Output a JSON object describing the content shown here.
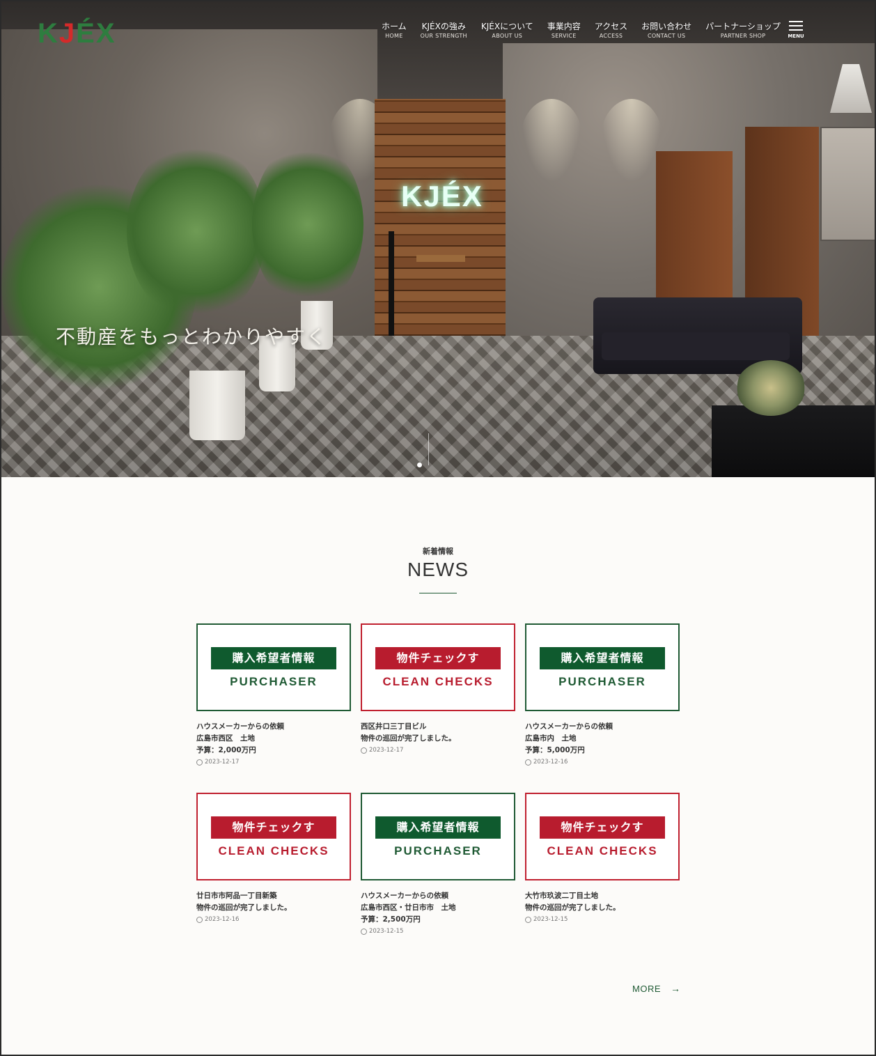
{
  "header": {
    "logo": {
      "k": "K",
      "j": "J",
      "ex": "ÉX"
    },
    "nav": [
      {
        "jp": "ホーム",
        "en": "HOME"
      },
      {
        "jp": "KJÉXの強み",
        "en": "OUR STRENGTH"
      },
      {
        "jp": "KJÉXについて",
        "en": "ABOUT US"
      },
      {
        "jp": "事業内容",
        "en": "SERVICE"
      },
      {
        "jp": "アクセス",
        "en": "ACCESS"
      },
      {
        "jp": "お問い合わせ",
        "en": "CONTACT US"
      },
      {
        "jp": "パートナーショップ",
        "en": "PARTNER SHOP"
      }
    ],
    "menu_label": "MENU"
  },
  "hero": {
    "tagline": "不動産をもっとわかりやすく",
    "sign_text": "KJÉX"
  },
  "news": {
    "subtitle": "新着情報",
    "title": "NEWS",
    "items": [
      {
        "type": "green",
        "band": "購入希望者情報",
        "en": "PURCHASER",
        "lines": [
          "ハウスメーカーからの依頼",
          "広島市西区　土地",
          "予算：2,000万円"
        ],
        "date": "2023-12-17"
      },
      {
        "type": "red",
        "band": "物件チェックす",
        "en": "CLEAN CHECKS",
        "lines": [
          "西区井口三丁目ビル",
          "物件の巡回が完了しました。"
        ],
        "date": "2023-12-17"
      },
      {
        "type": "green",
        "band": "購入希望者情報",
        "en": "PURCHASER",
        "lines": [
          "ハウスメーカーからの依頼",
          "広島市内　土地",
          "予算：5,000万円"
        ],
        "date": "2023-12-16"
      },
      {
        "type": "red",
        "band": "物件チェックす",
        "en": "CLEAN CHECKS",
        "lines": [
          "廿日市市阿品一丁目新築",
          "物件の巡回が完了しました。"
        ],
        "date": "2023-12-16"
      },
      {
        "type": "green",
        "band": "購入希望者情報",
        "en": "PURCHASER",
        "lines": [
          "ハウスメーカーからの依頼",
          "広島市西区・廿日市市　土地",
          "予算：2,500万円"
        ],
        "date": "2023-12-15"
      },
      {
        "type": "red",
        "band": "物件チェックす",
        "en": "CLEAN CHECKS",
        "lines": [
          "大竹市玖波二丁目土地",
          "物件の巡回が完了しました。"
        ],
        "date": "2023-12-15"
      }
    ],
    "more_label": "MORE",
    "more_arrow": "→"
  },
  "colors": {
    "green": "#1f5a34",
    "red": "#b81c2e",
    "logo_green": "#2e7d3f",
    "logo_red": "#d42a2a"
  }
}
